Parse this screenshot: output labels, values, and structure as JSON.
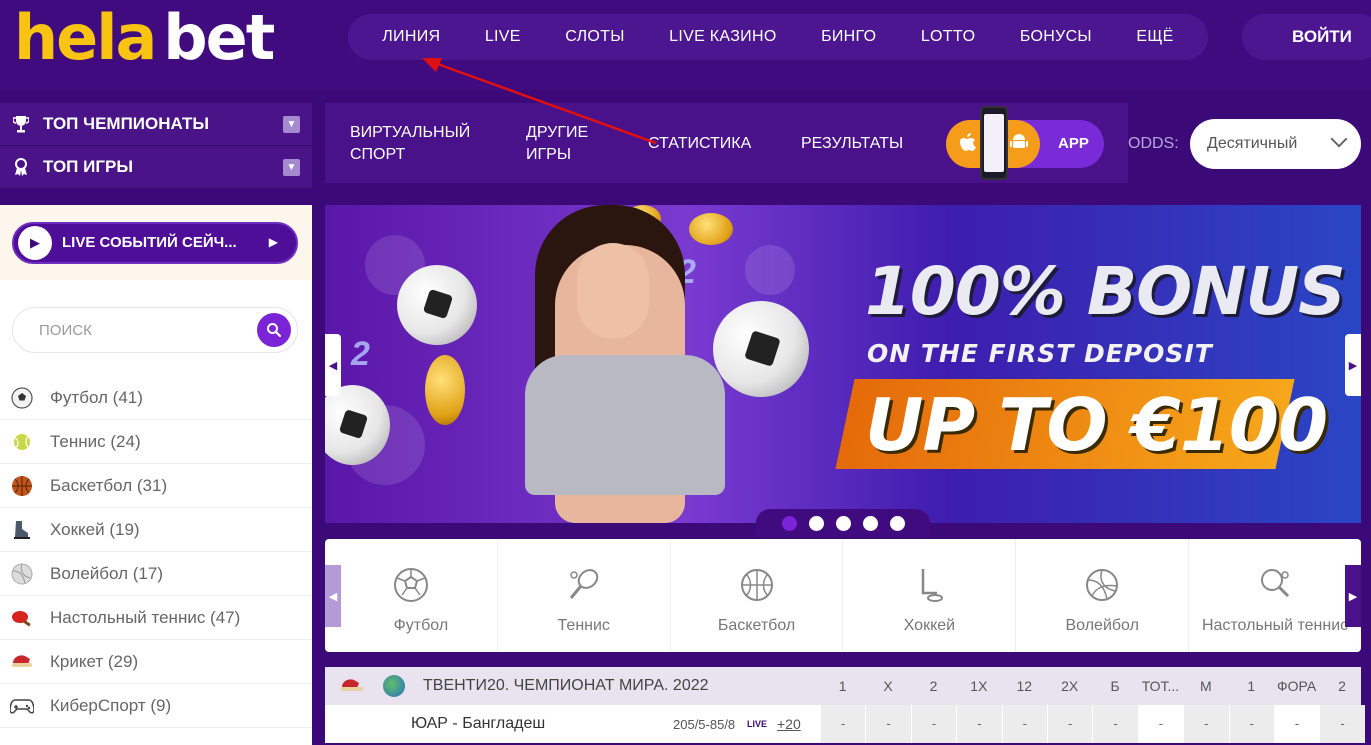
{
  "logo": {
    "part1": "hela",
    "part2": "bet"
  },
  "topnav": [
    "ЛИНИЯ",
    "LIVE",
    "СЛОТЫ",
    "LIVE КАЗИНО",
    "БИНГО",
    "LOTTO",
    "БОНУСЫ",
    "ЕЩЁ"
  ],
  "login_label": "ВОЙТИ",
  "left_top": [
    {
      "label": "ТОП ЧЕМПИОНАТЫ",
      "icon": "trophy-icon"
    },
    {
      "label": "ТОП ИГРЫ",
      "icon": "medal-icon"
    }
  ],
  "live_button_label": "LIVE СОБЫТИЙ СЕЙЧ...",
  "search_placeholder": "ПОИСК",
  "sports": [
    {
      "label": "Футбол (41)",
      "icon": "football-icon"
    },
    {
      "label": "Теннис (24)",
      "icon": "tennis-icon"
    },
    {
      "label": "Баскетбол (31)",
      "icon": "basketball-icon"
    },
    {
      "label": "Хоккей (19)",
      "icon": "hockey-icon"
    },
    {
      "label": "Волейбол (17)",
      "icon": "volleyball-icon"
    },
    {
      "label": "Настольный теннис (47)",
      "icon": "table-tennis-icon"
    },
    {
      "label": "Крикет (29)",
      "icon": "cricket-icon"
    },
    {
      "label": "КиберСпорт (9)",
      "icon": "gamepad-icon"
    }
  ],
  "subnav": [
    {
      "line1": "ВИРТУАЛЬНЫЙ",
      "line2": "СПОРТ"
    },
    {
      "line1": "ДРУГИЕ",
      "line2": "ИГРЫ"
    },
    {
      "line1": "СТАТИСТИКА",
      "line2": ""
    },
    {
      "line1": "РЕЗУЛЬТАТЫ",
      "line2": ""
    }
  ],
  "app_label": "APP",
  "odds_label": "ODDS:",
  "odds_value": "Десятичный",
  "banner": {
    "line1": "100% BONUS",
    "line2": "ON THE FIRST DEPOSIT",
    "line3": "UP TO €100",
    "slide_count": 5,
    "active_slide": 1
  },
  "carousel": [
    {
      "label": "Футбол",
      "icon": "football-icon"
    },
    {
      "label": "Теннис",
      "icon": "tennis-icon"
    },
    {
      "label": "Баскетбол",
      "icon": "basketball-icon"
    },
    {
      "label": "Хоккей",
      "icon": "hockey-icon"
    },
    {
      "label": "Волейбол",
      "icon": "volleyball-icon"
    },
    {
      "label": "Настольный теннис",
      "icon": "table-tennis-icon"
    }
  ],
  "match_table": {
    "league": "ТВЕНТИ20. ЧЕМПИОНАТ МИРА. 2022",
    "columns": [
      "1",
      "X",
      "2",
      "1X",
      "12",
      "2X",
      "Б",
      "ТОТ...",
      "М",
      "1",
      "ФОРА",
      "2"
    ],
    "row": {
      "teams": "ЮАР - Бангладеш",
      "score": "205/5-85/8",
      "live": "LIVE",
      "more": "+20",
      "odds": [
        "-",
        "-",
        "-",
        "-",
        "-",
        "-",
        "-",
        "-",
        "-",
        "-",
        "-",
        "-"
      ]
    }
  },
  "colors": {
    "brand_purple": "#3f0b7e",
    "accent_yellow": "#f8c311",
    "accent_orange": "#f59c1a",
    "accent_violet": "#7b23d6",
    "annotation_red": "#e01010"
  }
}
